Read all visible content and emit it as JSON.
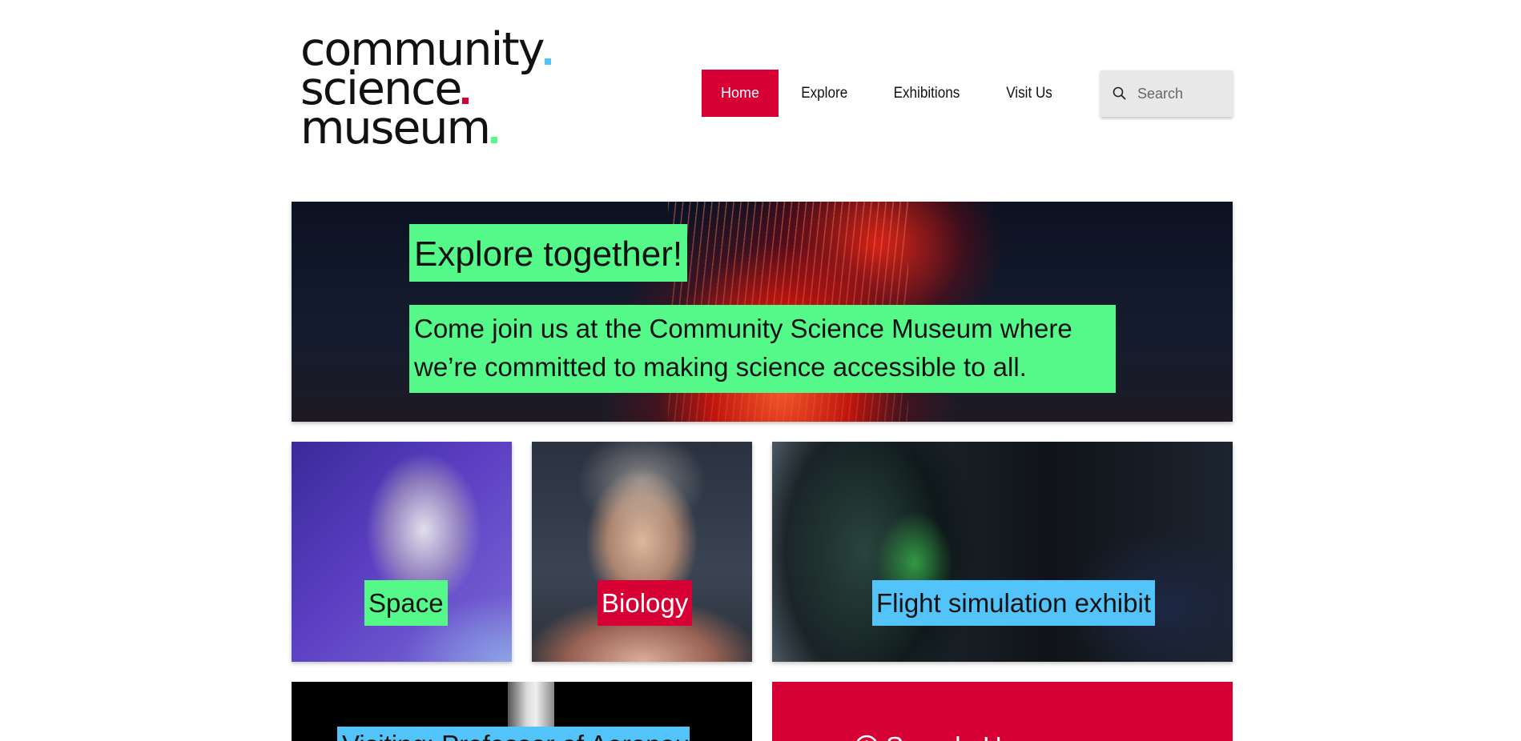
{
  "logo": {
    "line1": "community",
    "line2": "science",
    "line3": "museum"
  },
  "nav": {
    "items": [
      {
        "label": "Home",
        "active": true
      },
      {
        "label": "Explore",
        "active": false
      },
      {
        "label": "Exhibitions",
        "active": false
      },
      {
        "label": "Visit Us",
        "active": false
      }
    ]
  },
  "search": {
    "placeholder": "Search",
    "icon": "search-icon"
  },
  "hero": {
    "title": "Explore together!",
    "text": "Come join us at the Community Science Museum where we’re committed to making science accessible to all."
  },
  "tiles": [
    {
      "label": "Space"
    },
    {
      "label": "Biology"
    },
    {
      "label": "Flight simulation exhibit"
    }
  ],
  "bottom": {
    "left_label": "Visiting: Professor of Aeronautics",
    "right_label": "Sample Here",
    "right_icon": "circle-plus-icon"
  },
  "colors": {
    "accent_red": "#d70034",
    "accent_green": "#55f98a",
    "accent_blue": "#53c4f9",
    "logo_dot_1": "#53c4f9",
    "logo_dot_2": "#d70034",
    "logo_dot_3": "#55f98a"
  }
}
